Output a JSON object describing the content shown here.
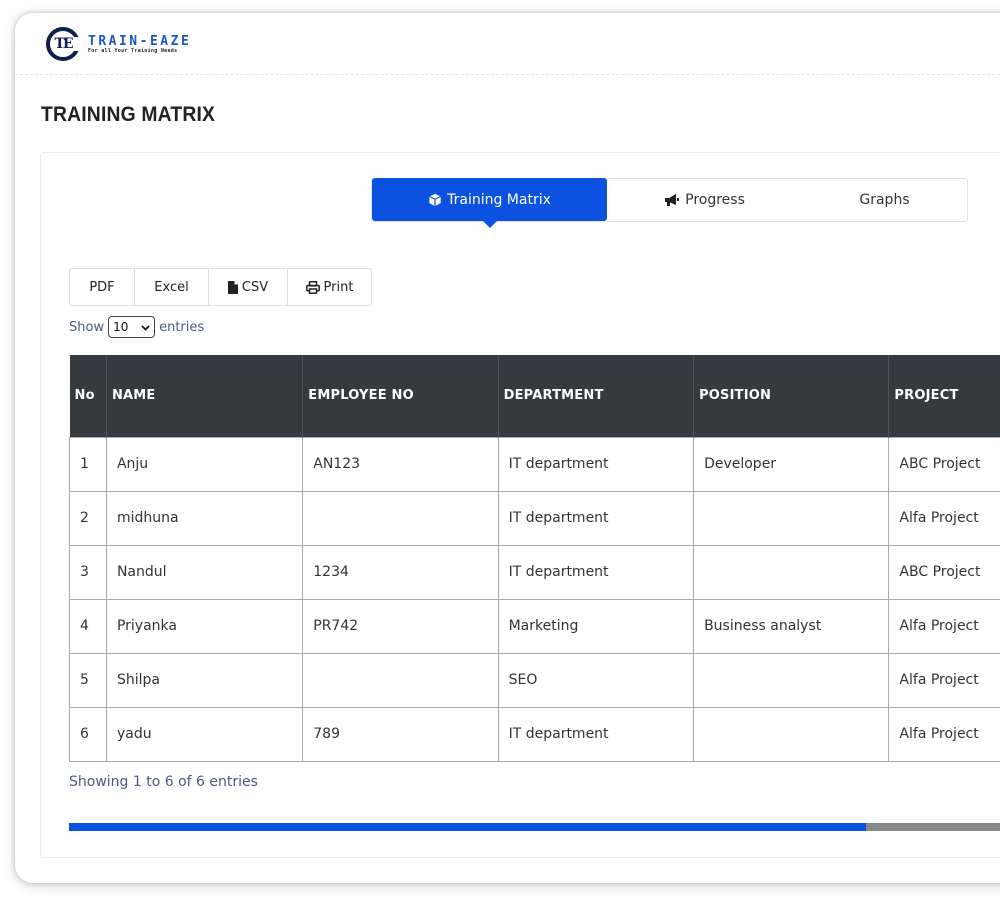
{
  "brand": {
    "name": "TRAIN-EAZE",
    "tagline": "For all Your Training Needs",
    "mark": "TE"
  },
  "page": {
    "title": "TRAINING MATRIX"
  },
  "tabs": [
    {
      "label": "Training Matrix",
      "icon": "cube-icon",
      "active": true
    },
    {
      "label": "Progress",
      "icon": "bullhorn-icon",
      "active": false
    },
    {
      "label": "Graphs",
      "icon": "",
      "active": false
    }
  ],
  "export_buttons": [
    {
      "label": "PDF"
    },
    {
      "label": "Excel"
    },
    {
      "label": "CSV",
      "icon": "file-icon"
    },
    {
      "label": "Print",
      "icon": "print-icon"
    }
  ],
  "length_menu": {
    "prefix": "Show",
    "value": "10",
    "suffix": "entries"
  },
  "table": {
    "columns": [
      "No",
      "NAME",
      "EMPLOYEE NO",
      "DEPARTMENT",
      "POSITION",
      "PROJECT"
    ],
    "rows": [
      [
        "1",
        "Anju",
        "AN123",
        "IT department",
        "Developer",
        "ABC Project"
      ],
      [
        "2",
        "midhuna",
        "",
        "IT department",
        "",
        "Alfa Project"
      ],
      [
        "3",
        "Nandul",
        "1234",
        "IT department",
        "",
        "ABC Project"
      ],
      [
        "4",
        "Priyanka",
        "PR742",
        "Marketing",
        "Business analyst",
        "Alfa Project"
      ],
      [
        "5",
        "Shilpa",
        "",
        "SEO",
        "",
        "Alfa Project"
      ],
      [
        "6",
        "yadu",
        "789",
        "IT department",
        "",
        "Alfa Project"
      ]
    ]
  },
  "info": "Showing 1 to 6 of 6 entries",
  "scroll": {
    "position_fraction": 0.82
  },
  "colors": {
    "primary": "#0b52e0",
    "header_bg": "#343a40",
    "brand_blue": "#1f57c3"
  }
}
